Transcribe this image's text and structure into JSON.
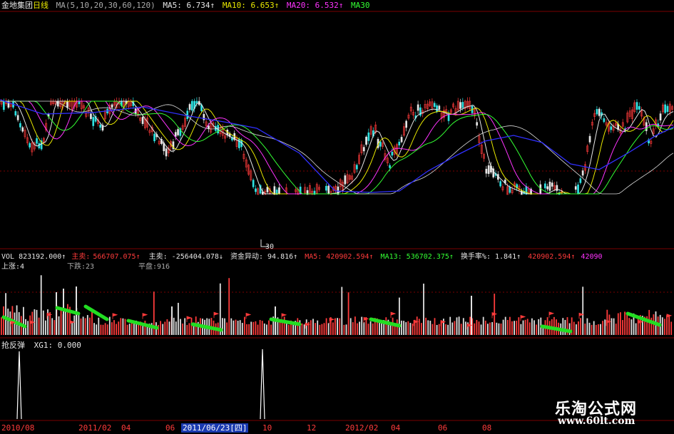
{
  "colors": {
    "bg": "#000000",
    "up": "#ff3b3b",
    "down": "#2ee2e2",
    "white": "#e6e6e6",
    "yellow": "#e8e800",
    "magenta": "#ff33ff",
    "green": "#33ff33",
    "blue": "#3030ff",
    "grid_red": "#7a0000",
    "vol_green": "#22dd22"
  },
  "price_header": {
    "stock": "金地集团",
    "period": "日线",
    "ma_params": "MA(5,10,20,30,60,120)",
    "ma5": "MA5: 6.734↑",
    "ma10": "MA10: 6.653↑",
    "ma20": "MA20: 6.532↑",
    "ma30": "MA30"
  },
  "marker": "30",
  "vol_header": {
    "vol": "VOL 823192.000↑",
    "zhumai": "主买: 566707.075↑",
    "zhumai_short": "主卖:",
    "zhumai_val": "566707.075↑",
    "zhu": "主卖: -256404.078↓",
    "fund": "资金异动: 94.816↑",
    "ma5": "MA5: 420902.594↑",
    "ma13": "MA13: 536702.375↑",
    "turnover": "换手率%: 1.841↑",
    "last": "420902.594↑",
    "last2": "42090"
  },
  "breadth": {
    "up": "上涨:4",
    "down": "下跌:23",
    "flat": "平盘:916"
  },
  "indicator_header": {
    "name": "抢反弹",
    "xg": "XG1: 0.000"
  },
  "dates": {
    "d1": "2010/08",
    "d2": "2011/02",
    "d3": "04",
    "d4": "06",
    "selected": "2011/06/23[四]",
    "d5": "10",
    "d6": "12",
    "d7": "2012/02",
    "d8": "04",
    "d9": "06",
    "d10": "08"
  },
  "watermark": {
    "name": "乐淘公式网",
    "url": "www.60lt.com"
  }
}
